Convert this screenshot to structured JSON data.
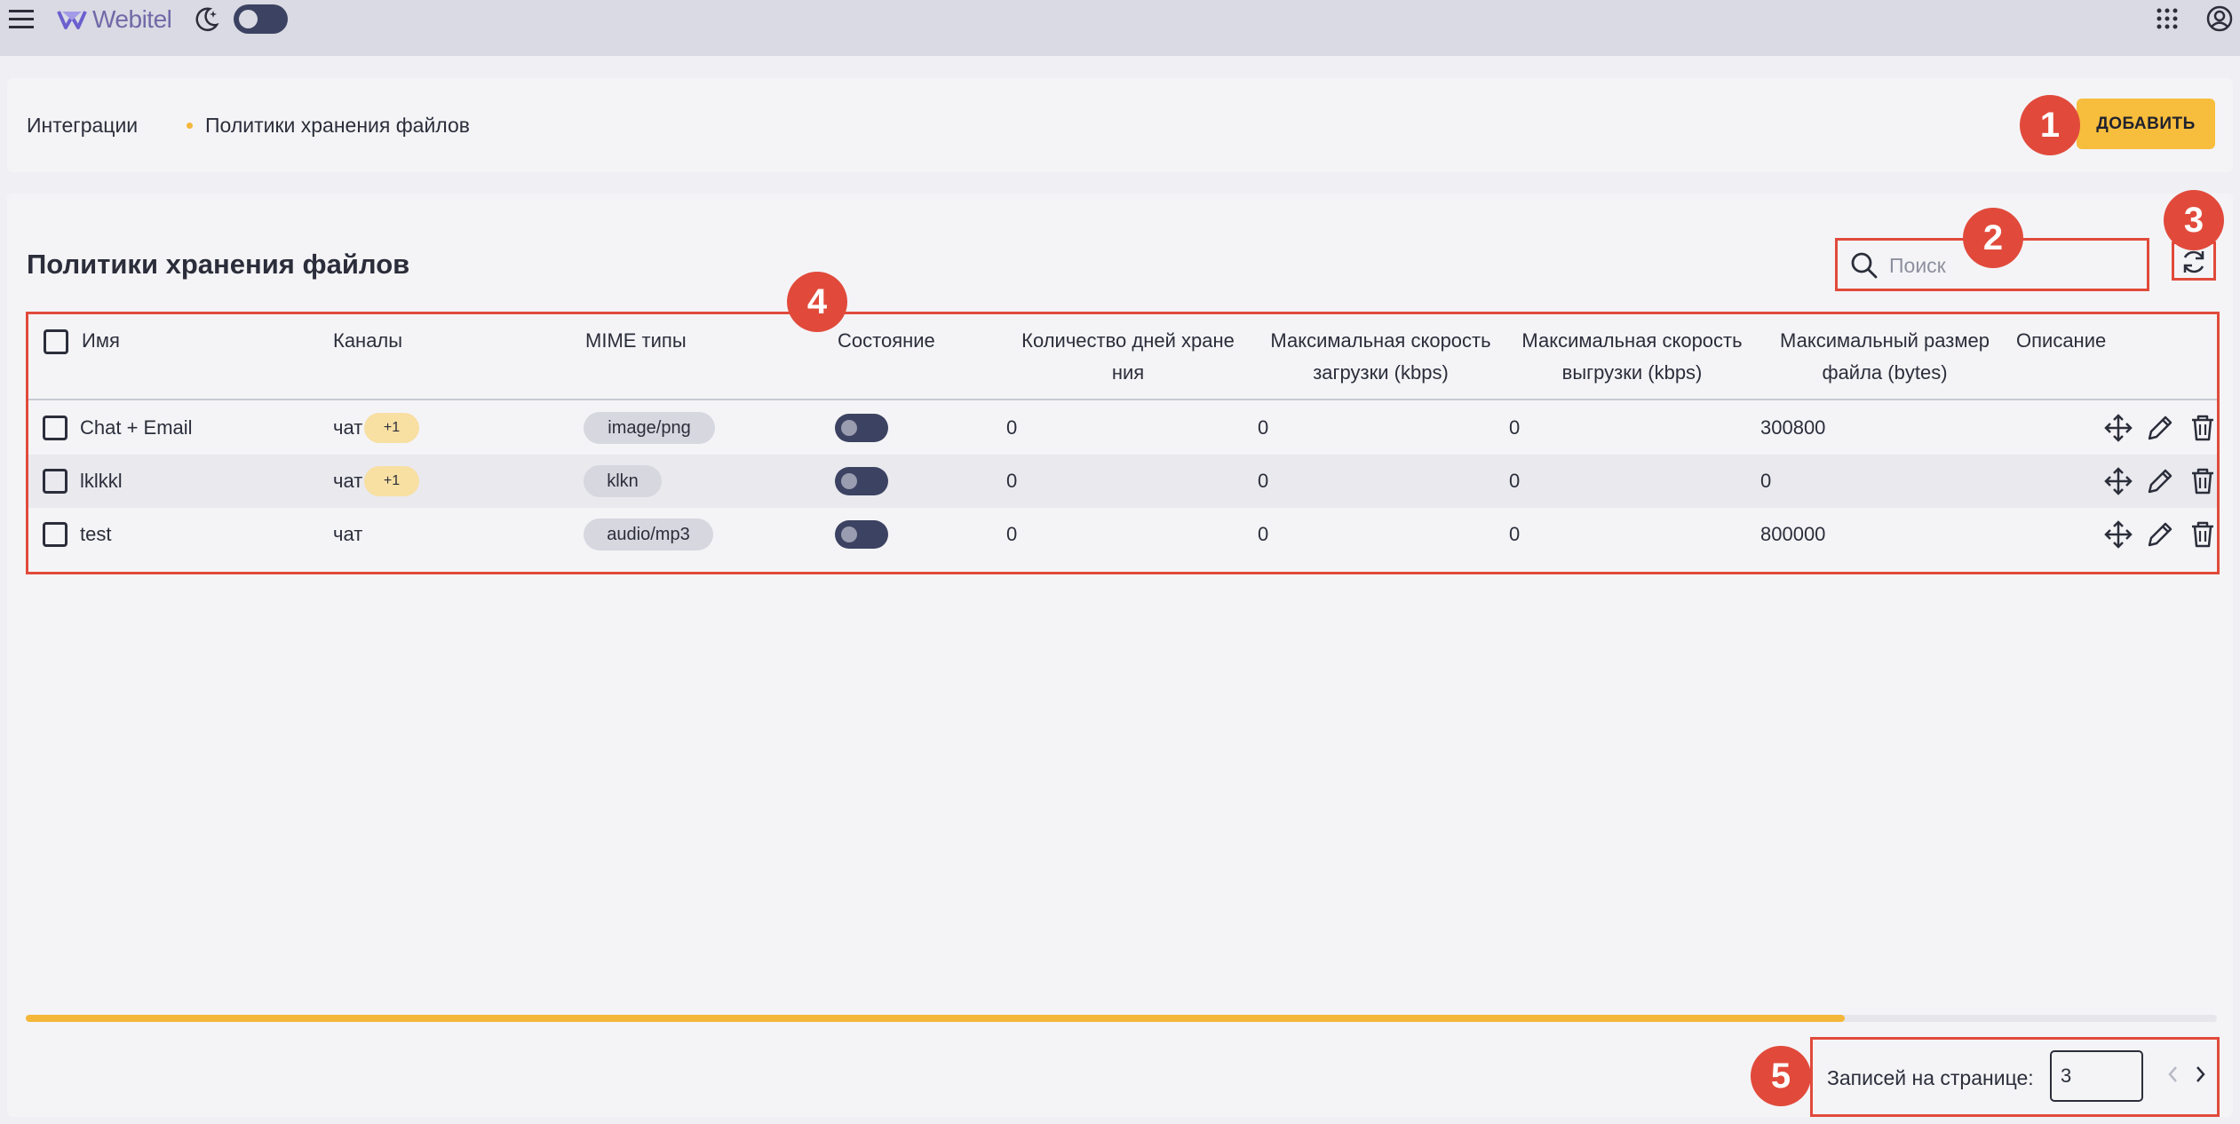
{
  "topbar": {
    "logo_text": "Webitel"
  },
  "breadcrumb": {
    "items": [
      "Интеграции",
      "Политики хранения файлов"
    ]
  },
  "header": {
    "add_label": "ДОБАВИТЬ"
  },
  "page": {
    "title": "Политики хранения файлов"
  },
  "search": {
    "placeholder": "Поиск"
  },
  "table": {
    "columns": [
      "Имя",
      "Каналы",
      "MIME типы",
      "Состояние",
      [
        "Количество дней хране",
        "ния"
      ],
      [
        "Максимальная скорость",
        "загрузки (kbps)"
      ],
      [
        "Максимальная скорость",
        "выгрузки (kbps)"
      ],
      [
        "Максимальный размер",
        "файла (bytes)"
      ],
      "Описание"
    ],
    "rows": [
      {
        "name": "Chat + Email",
        "channel": "чат",
        "channel_extra": "+1",
        "mime": "image/png",
        "enabled": false,
        "days": "0",
        "upload": "0",
        "download": "0",
        "max_size": "300800",
        "description": ""
      },
      {
        "name": "lklkkl",
        "channel": "чат",
        "channel_extra": "+1",
        "mime": "klkn",
        "enabled": false,
        "days": "0",
        "upload": "0",
        "download": "0",
        "max_size": "0",
        "description": ""
      },
      {
        "name": "test",
        "channel": "чат",
        "channel_extra": "",
        "mime": "audio/mp3",
        "enabled": false,
        "days": "0",
        "upload": "0",
        "download": "0",
        "max_size": "800000",
        "description": ""
      }
    ]
  },
  "scrollbar": {
    "position_fraction": 0.83
  },
  "pagination": {
    "per_page_label": "Записей на странице:",
    "per_page_value": "3"
  },
  "callouts": [
    "1",
    "2",
    "3",
    "4",
    "5"
  ],
  "colors": {
    "accent": "#f7bd3c",
    "callout": "#e14a3b",
    "toggle": "#3c4261",
    "topbar": "#d9dae3"
  },
  "icons": [
    "menu-icon",
    "webitel-logo-icon",
    "moon-icon",
    "apps-grid-icon",
    "account-icon",
    "search-icon",
    "refresh-icon",
    "move-icon",
    "edit-icon",
    "delete-icon",
    "chevron-left-icon",
    "chevron-right-icon"
  ]
}
